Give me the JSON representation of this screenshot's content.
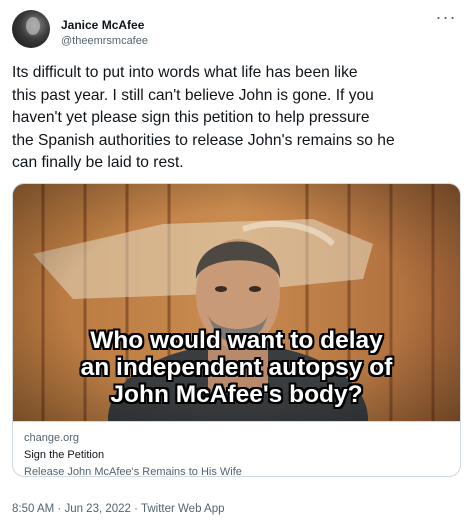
{
  "author": {
    "name": "Janice McAfee",
    "handle": "@theemrsmcafee",
    "avatar_icon": "profile-photo"
  },
  "more_icon": "more-horizontal-icon",
  "tweet": {
    "lines": [
      "Its difficult to put into words what life has been like",
      "this past year. I still can't believe John is gone. If you",
      "haven't yet please sign this petition to help pressure",
      "the Spanish authorities to release John's remains so he",
      "can finally be laid to rest."
    ]
  },
  "card": {
    "meme_lines": [
      "Who would want to delay",
      "an independent autopsy of",
      "John McAfee's body?"
    ],
    "domain": "change.org",
    "title": "Sign the Petition",
    "description": "Release John McAfee's Remains to His Wife"
  },
  "meta": {
    "time": "8:50 AM",
    "separator": " · ",
    "date": "Jun 23, 2022",
    "source": "Twitter Web App"
  },
  "colors": {
    "text": "#0f1419",
    "secondary": "#536471",
    "border": "#cfd9de"
  }
}
